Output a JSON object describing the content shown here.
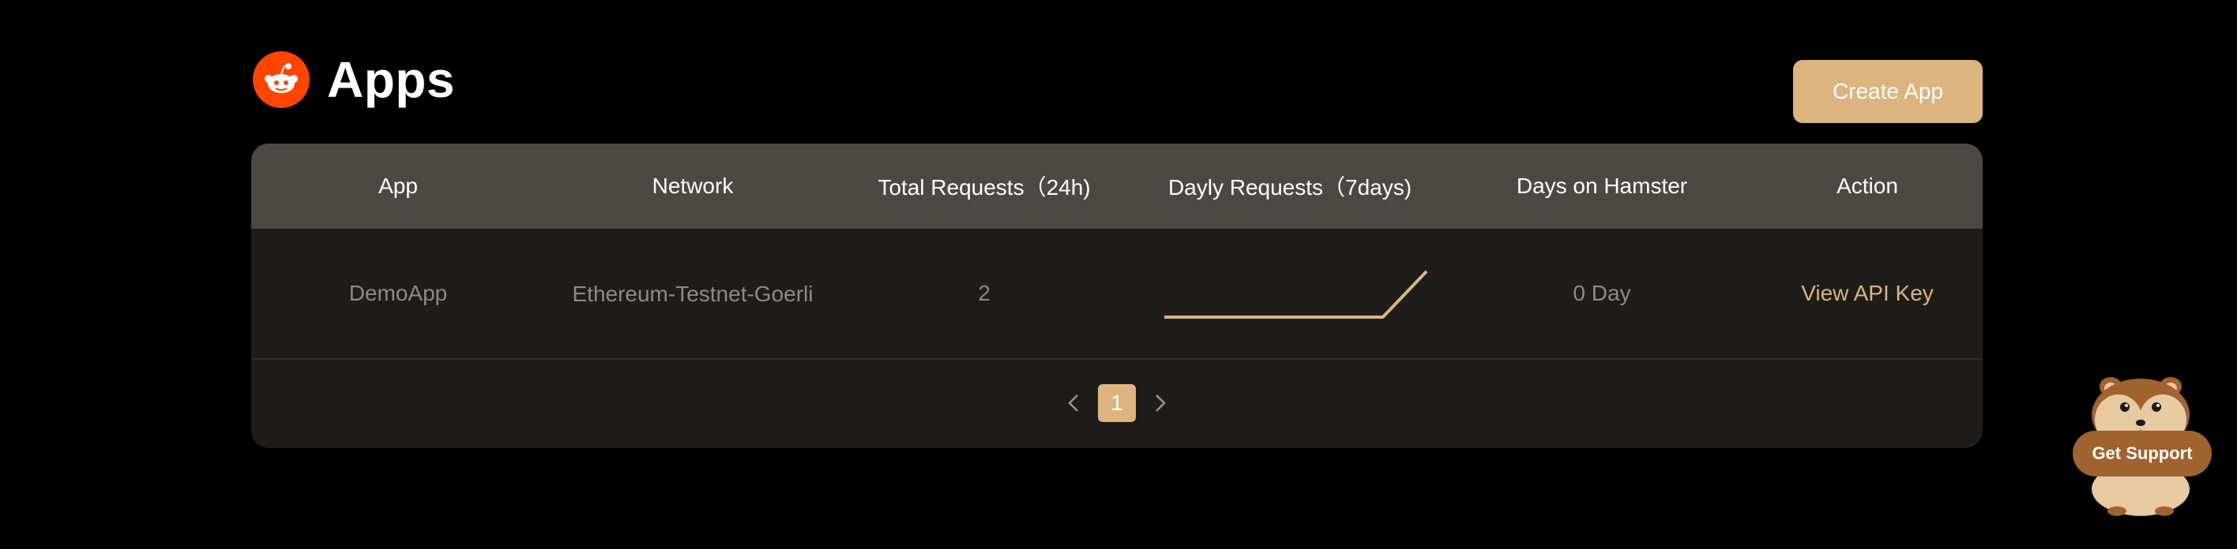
{
  "header": {
    "title": "Apps",
    "logo_icon": "reddit-logo-icon"
  },
  "actions": {
    "create_app_label": "Create App"
  },
  "table": {
    "columns": [
      "App",
      "Network",
      "Total Requests（24h)",
      "Dayly Requests（7days)",
      "Days on Hamster",
      "Action"
    ],
    "rows": [
      {
        "app": "DemoApp",
        "network": "Ethereum-Testnet-Goerli",
        "total_requests": "2",
        "daily_requests_7d": [
          0,
          0,
          0,
          0,
          0,
          0,
          2
        ],
        "days_on_hamster": "0 Day",
        "action": "View API Key"
      }
    ]
  },
  "pagination": {
    "prev_icon": "chevron-left-icon",
    "current_page": "1",
    "next_icon": "chevron-right-icon"
  },
  "support": {
    "label": "Get Support",
    "icon": "hamster-mascot-icon"
  },
  "colors": {
    "accent": "#dcb47f",
    "header_bg": "#4c4944",
    "card_bg": "#1e1d1b",
    "page_bg": "#000000"
  }
}
